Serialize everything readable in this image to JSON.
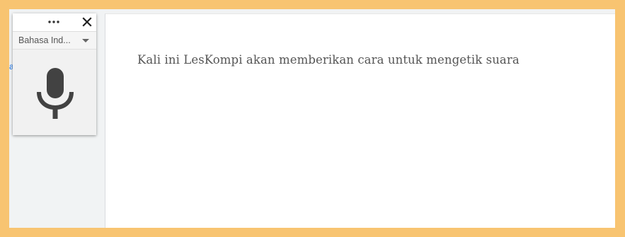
{
  "voice_typing": {
    "more_icon": "more-horizontal-icon",
    "close_icon": "close-icon",
    "language": "Bahasa Ind...",
    "mic_icon": "microphone-icon"
  },
  "document": {
    "text": "Kali ini LesKompi akan memberikan cara untuk mengetik suara"
  },
  "sidebar": {
    "cut_char": "a"
  },
  "colors": {
    "frame_border": "#f8c471",
    "app_background": "#f1f3f4",
    "mic_color": "#424242",
    "text_color": "#555555"
  }
}
